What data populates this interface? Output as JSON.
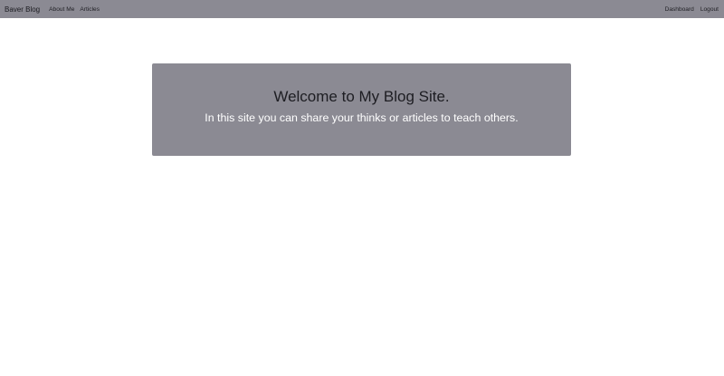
{
  "colors": {
    "navbar_bg": "#8b8a93",
    "jumbotron_bg": "#8b8a93",
    "page_bg": "#ffffff"
  },
  "navbar": {
    "brand": "Baver Blog",
    "left_links": [
      "About Me",
      "Articles"
    ],
    "right_links": [
      "Dashboard",
      "Logout"
    ]
  },
  "jumbotron": {
    "title": "Welcome to My Blog Site.",
    "subtitle": "In this site you can share your thinks or articles to teach others."
  }
}
